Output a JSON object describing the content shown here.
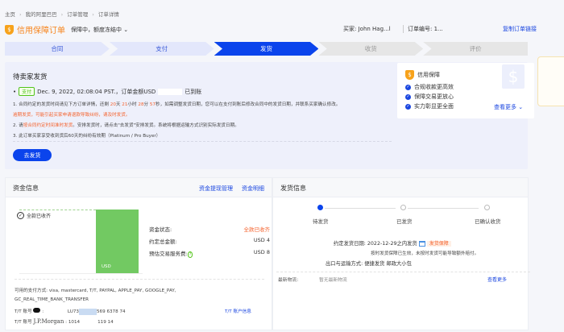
{
  "breadcrumb": [
    "主页",
    "我的阿里巴巴",
    "订单管理",
    "订单详情"
  ],
  "header": {
    "title": "信用保障订单",
    "status": "保障中，额度冻结中",
    "buyer_label": "买家:",
    "buyer": "John Hag...l",
    "order_no_label": "订单编号:",
    "order_no": "1...",
    "copy_link": "复制订单链接"
  },
  "steps": [
    {
      "label": "合同",
      "state": "done"
    },
    {
      "label": "支付",
      "state": "done"
    },
    {
      "label": "发货",
      "state": "current"
    },
    {
      "label": "收货",
      "state": "todo"
    },
    {
      "label": "评价",
      "state": "todo"
    }
  ],
  "status": {
    "title": "待卖家发货",
    "tag": "支付",
    "pay_text": "Dec. 9, 2022, 02:08:04 PST.，订单金额USD",
    "pay_suffix": "已到账",
    "note1_a": "1. 合同约定的发货时间请见下方订单详情，还剩",
    "days": "20",
    "days_u": "天",
    "hours": "21",
    "hours_u": "小时",
    "mins": "28",
    "mins_u": "分",
    "secs": "57",
    "secs_u": "秒",
    "note1_b": "，如需调整发货日期，您可以在支付到账后修改合同中的发货日期，并联系买家确认修改。",
    "note1_warn": "逾期发货，可能引起买家申请退款导致纠纷，请及时发货。",
    "note2_a": "2. 请",
    "note2_hl": "按合同约定时间准时发货",
    "note2_b": "。安排发货时，请点击\"去发货\"安排发货。系统将根据运输方式识别实际发货日期。",
    "note3": "3. 此订单买家享受收到货后60天的纠纷有效期（Platinum / Pro Buyer）",
    "ship_button": "去发货"
  },
  "guarantee": {
    "title": "信用保障",
    "items": [
      "合规收款更高效",
      "保障交易更放心",
      "实力彰显更全面"
    ],
    "more": "查看更多"
  },
  "funds": {
    "title": "资金信息",
    "links": [
      "资金提现管理",
      "资金明细"
    ],
    "received": "全款已收齐",
    "bar_label": "USD",
    "status_label": "资金状态:",
    "status_value": "全款已收齐",
    "total_label": "约定总金额:",
    "total_value": "USD 4",
    "fee_label": "预估交易服务费:",
    "fee_value": "USD 8",
    "methods": "可用的支付方式: visa, mastercard, T/T, PAYPAL, APPLE_PAY, GOOGLE_PAY,",
    "methods2": "GC_REAL_TIME_BANK_TRANSFER",
    "tt1_label": "T/T 账号",
    "tt1_a": "LU73",
    "tt1_b": "569 6378 74",
    "tt_info": "T/T 账户信息",
    "tt2_label": "T/T 账号",
    "tt2_bank": "J.P.Morgan",
    "tt2_a": "1014",
    "tt2_b": "119 14"
  },
  "shipping": {
    "title": "发货信息",
    "steps": [
      "待发货",
      "已发货",
      "已确认收货"
    ],
    "date_label": "约定发货日期:",
    "date_value": "2022-12-29之内发货",
    "badge": "发货保障",
    "date_note": "按时发货保障已生效，未按时发货可能导致额外赔付。",
    "method_label": "出口与运输方式:",
    "method_value": "便捷发货 邮政大小包",
    "logistics_label": "最新物流:",
    "logistics_value": "暂无最新物流",
    "more": "查看更多"
  },
  "colors": {
    "accent": "#0b44ec",
    "orange": "#f5622d",
    "green": "#72c962"
  }
}
